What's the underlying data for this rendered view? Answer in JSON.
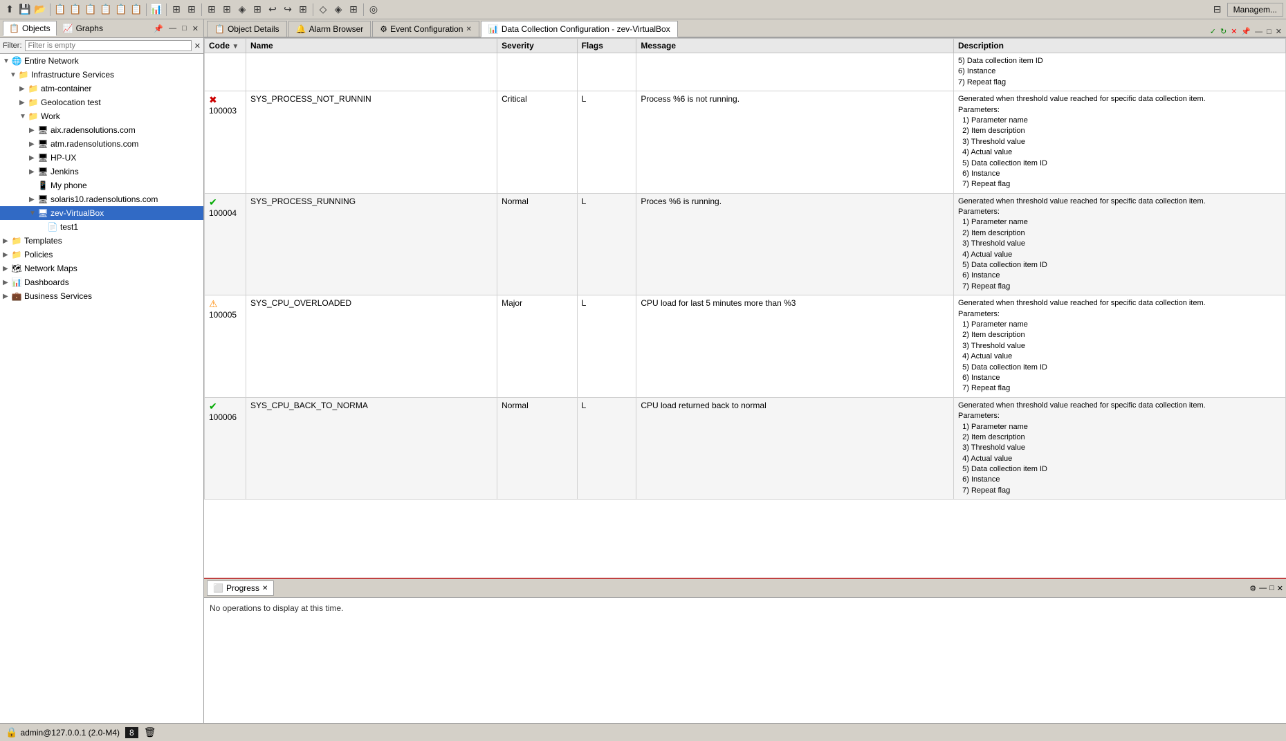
{
  "toolbar": {
    "management_label": "Managem...",
    "icons": [
      "⬆",
      "💾",
      "📂",
      "📋",
      "📋",
      "📋",
      "📋",
      "📋",
      "📋",
      "📊",
      "⊞",
      "⊞",
      "⊞",
      "⊞",
      "⊞",
      "⊞",
      "⊞",
      "⊞",
      "⊞",
      "⊞"
    ]
  },
  "left_panel": {
    "tabs": [
      {
        "id": "objects",
        "label": "Objects",
        "active": true
      },
      {
        "id": "graphs",
        "label": "Graphs",
        "active": false
      }
    ],
    "filter": {
      "label": "Filter:",
      "placeholder": "Filter is empty"
    },
    "tree": [
      {
        "id": "entire-network",
        "label": "Entire Network",
        "level": 0,
        "expanded": true,
        "icon": "🌐",
        "type": "root"
      },
      {
        "id": "infrastructure",
        "label": "Infrastructure Services",
        "level": 1,
        "expanded": true,
        "icon": "📁",
        "type": "folder"
      },
      {
        "id": "atm-container",
        "label": "atm-container",
        "level": 2,
        "expanded": false,
        "icon": "📁",
        "type": "folder"
      },
      {
        "id": "geolocation",
        "label": "Geolocation test",
        "level": 2,
        "expanded": false,
        "icon": "📁",
        "type": "folder"
      },
      {
        "id": "work",
        "label": "Work",
        "level": 2,
        "expanded": true,
        "icon": "📁",
        "type": "folder"
      },
      {
        "id": "aix",
        "label": "aix.radensolutions.com",
        "level": 3,
        "expanded": false,
        "icon": "🖥",
        "type": "node"
      },
      {
        "id": "atm",
        "label": "atm.radensolutions.com",
        "level": 3,
        "expanded": false,
        "icon": "🖥",
        "type": "node"
      },
      {
        "id": "hp-ux",
        "label": "HP-UX",
        "level": 3,
        "expanded": false,
        "icon": "🖥",
        "type": "node"
      },
      {
        "id": "jenkins",
        "label": "Jenkins",
        "level": 3,
        "expanded": false,
        "icon": "🖥",
        "type": "node"
      },
      {
        "id": "myphome",
        "label": "My phone",
        "level": 3,
        "expanded": false,
        "icon": "📱",
        "type": "node"
      },
      {
        "id": "solaris10",
        "label": "solaris10.radensolutions.com",
        "level": 3,
        "expanded": false,
        "icon": "🖥",
        "type": "node"
      },
      {
        "id": "zev-virtualbox",
        "label": "zev-VirtualBox",
        "level": 3,
        "expanded": true,
        "icon": "🖥",
        "type": "node",
        "selected": true
      },
      {
        "id": "test1",
        "label": "test1",
        "level": 4,
        "expanded": false,
        "icon": "📄",
        "type": "item"
      },
      {
        "id": "templates",
        "label": "Templates",
        "level": 0,
        "expanded": false,
        "icon": "📁",
        "type": "folder"
      },
      {
        "id": "policies",
        "label": "Policies",
        "level": 0,
        "expanded": false,
        "icon": "📁",
        "type": "folder"
      },
      {
        "id": "network-maps",
        "label": "Network Maps",
        "level": 0,
        "expanded": false,
        "icon": "🗺",
        "type": "folder"
      },
      {
        "id": "dashboards",
        "label": "Dashboards",
        "level": 0,
        "expanded": false,
        "icon": "📊",
        "type": "folder"
      },
      {
        "id": "business-services",
        "label": "Business Services",
        "level": 0,
        "expanded": false,
        "icon": "💼",
        "type": "folder"
      }
    ]
  },
  "tabs": [
    {
      "id": "object-details",
      "label": "Object Details",
      "icon": "📋",
      "active": false,
      "closable": false
    },
    {
      "id": "alarm-browser",
      "label": "Alarm Browser",
      "icon": "🔔",
      "active": false,
      "closable": false
    },
    {
      "id": "event-config",
      "label": "Event Configuration",
      "icon": "⚙",
      "active": false,
      "closable": true
    },
    {
      "id": "data-collection",
      "label": "Data Collection Configuration - zev-VirtualBox",
      "icon": "📊",
      "active": true,
      "closable": false
    }
  ],
  "tab_controls": {
    "green_btn": "✓",
    "refresh_btn": "↻",
    "close_btn": "✕",
    "pin_btn": "📌",
    "minimize_btn": "—",
    "maximize_btn": "□",
    "close_panel_btn": "✕"
  },
  "alarm_table": {
    "columns": [
      "Code",
      "Name",
      "Severity",
      "Flags",
      "Message",
      "Description"
    ],
    "rows": [
      {
        "id": 1,
        "status_icon": "error",
        "code": "100003",
        "name": "SYS_PROCESS_NOT_RUNNIN",
        "severity": "Critical",
        "flags": "L",
        "message": "Process %6 is not running.",
        "description": "5) Data collection item ID\n6) Instance\n7) Repeat flag\n\nGenerated when threshold value reached for specific data collection item.\nParameters:\n  1) Parameter name\n  2) Item description\n  3) Threshold value\n  4) Actual value\n  5) Data collection item ID\n  6) Instance\n  7) Repeat flag",
        "row_class": "row-odd"
      },
      {
        "id": 2,
        "status_icon": "ok",
        "code": "100004",
        "name": "SYS_PROCESS_RUNNING",
        "severity": "Normal",
        "flags": "L",
        "message": "Proces %6 is running.",
        "description": "Generated when threshold value reached for specific data collection item.\nParameters:\n  1) Parameter name\n  2) Item description\n  3) Threshold value\n  4) Actual value\n  5) Data collection item ID\n  6) Instance\n  7) Repeat flag",
        "row_class": "row-even"
      },
      {
        "id": 3,
        "status_icon": "warning",
        "code": "100005",
        "name": "SYS_CPU_OVERLOADED",
        "severity": "Major",
        "flags": "L",
        "message": "CPU load for last 5 minutes more than %3",
        "description": "Generated when threshold value reached for specific data collection item.\nParameters:\n  1) Parameter name\n  2) Item description\n  3) Threshold value\n  4) Actual value\n  5) Data collection item ID\n  6) Instance\n  7) Repeat flag",
        "row_class": "row-odd"
      },
      {
        "id": 4,
        "status_icon": "ok",
        "code": "100006",
        "name": "SYS_CPU_BACK_TO_NORMA",
        "severity": "Normal",
        "flags": "L",
        "message": "CPU load returned back to normal",
        "description": "Generated when threshold value reached for specific data collection item.\nParameters:\n  1) Parameter name\n  2) Item description\n  3) Threshold value\n  4) Actual value\n  5) Data collection item ID\n  6) Instance\n  7) Repeat flag",
        "row_class": "row-even"
      }
    ]
  },
  "bottom_panel": {
    "tab_label": "Progress",
    "tab_icon": "⬜",
    "no_operations_text": "No operations to display at this time."
  },
  "progress_header": "Progress %",
  "status_bar": {
    "user_text": "admin@127.0.0.1 (2.0-M4)",
    "counter": "8",
    "icon": "🔒"
  }
}
